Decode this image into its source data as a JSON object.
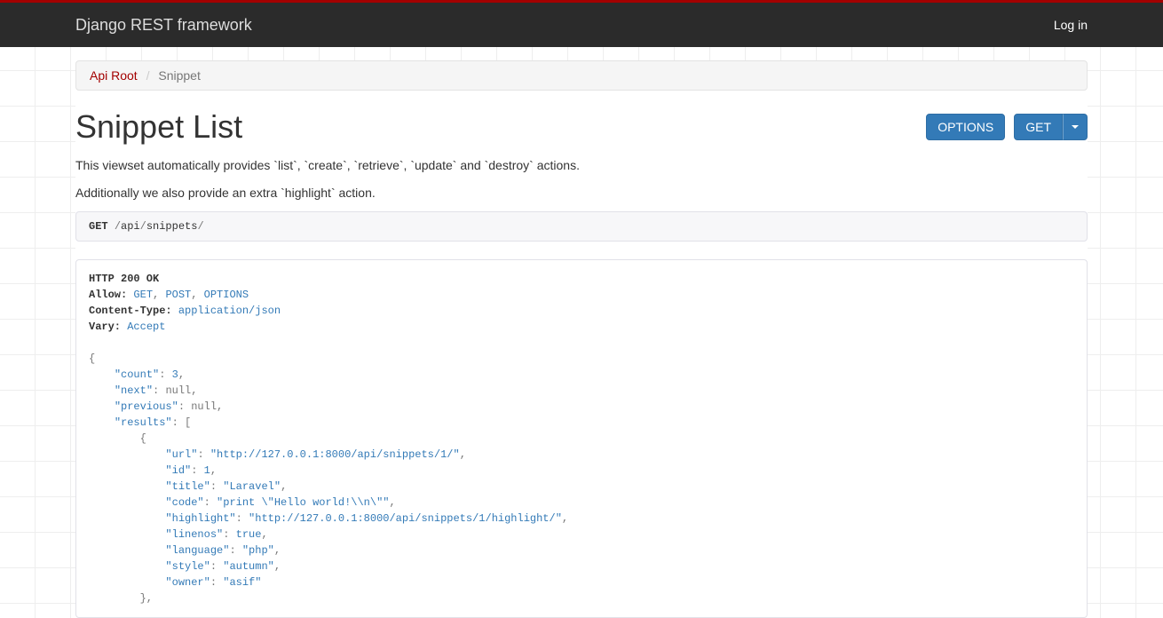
{
  "topbar": {
    "brand": "Django REST framework",
    "login": "Log in"
  },
  "breadcrumb": {
    "root": "Api Root",
    "sep": "/",
    "active": "Snippet"
  },
  "page": {
    "title": "Snippet List",
    "desc1": "This viewset automatically provides `list`, `create`, `retrieve`, `update` and `destroy` actions.",
    "desc2": "Additionally we also provide an extra `highlight` action."
  },
  "buttons": {
    "options": "OPTIONS",
    "get": "GET"
  },
  "request": {
    "method": "GET",
    "path_prefix": "/",
    "seg1": "api",
    "sep": "/",
    "seg2": "snippets",
    "path_suffix": "/"
  },
  "response": {
    "status": "HTTP 200 OK",
    "allow_label": "Allow:",
    "allow_get": "GET",
    "allow_post": "POST",
    "allow_options": "OPTIONS",
    "ctype_label": "Content-Type:",
    "ctype_val": "application/json",
    "vary_label": "Vary:",
    "vary_val": "Accept",
    "body": {
      "count": 3,
      "next": "null",
      "previous": "null",
      "results": [
        {
          "url": "\"http://127.0.0.1:8000/api/snippets/1/\"",
          "id": 1,
          "title": "\"Laravel\"",
          "code": "\"print \\\"Hello world!\\\\n\\\"\"",
          "highlight": "\"http://127.0.0.1:8000/api/snippets/1/highlight/\"",
          "linenos": "true",
          "language": "\"php\"",
          "style": "\"autumn\"",
          "owner": "\"asif\""
        }
      ]
    }
  }
}
